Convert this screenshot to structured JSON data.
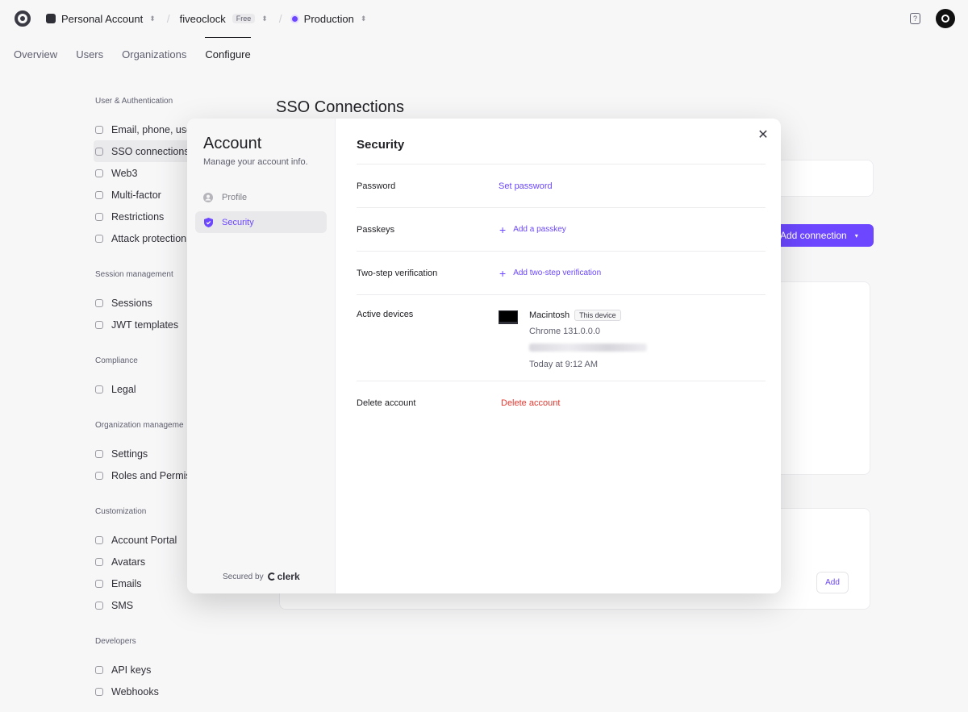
{
  "topbar": {
    "account": "Personal Account",
    "app": "fiveoclock",
    "plan_badge": "Free",
    "instance": "Production"
  },
  "tabs": [
    "Overview",
    "Users",
    "Organizations",
    "Configure"
  ],
  "sidebar": {
    "sections": [
      {
        "title": "User & Authentication",
        "items": [
          "Email, phone, use",
          "SSO connections",
          "Web3",
          "Multi-factor",
          "Restrictions",
          "Attack protection"
        ]
      },
      {
        "title": "Session management",
        "items": [
          "Sessions",
          "JWT templates"
        ]
      },
      {
        "title": "Compliance",
        "items": [
          "Legal"
        ]
      },
      {
        "title": "Organization manageme",
        "items": [
          "Settings",
          "Roles and Permis"
        ]
      },
      {
        "title": "Customization",
        "items": [
          "Account Portal",
          "Avatars",
          "Emails",
          "SMS"
        ]
      },
      {
        "title": "Developers",
        "items": [
          "API keys",
          "Webhooks"
        ]
      }
    ]
  },
  "main": {
    "title": "SSO Connections",
    "add_connection_label": "Add connection",
    "add_label": "Add"
  },
  "modal": {
    "title": "Account",
    "subtitle": "Manage your account info.",
    "nav": [
      {
        "label": "Profile",
        "icon": "user-circle-icon"
      },
      {
        "label": "Security",
        "icon": "shield-icon"
      }
    ],
    "secured_by": "Secured by",
    "brand": "clerk",
    "section_title": "Security",
    "rows": {
      "password": {
        "label": "Password",
        "action": "Set password"
      },
      "passkeys": {
        "label": "Passkeys",
        "action": "Add a passkey"
      },
      "two_step": {
        "label": "Two-step verification",
        "action": "Add two-step verification"
      },
      "devices": {
        "label": "Active devices",
        "device_name": "Macintosh",
        "this_device": "This device",
        "browser": "Chrome 131.0.0.0",
        "last_active": "Today at 9:12 AM"
      },
      "delete": {
        "label": "Delete account",
        "action": "Delete account"
      }
    }
  },
  "colors": {
    "accent": "#6c47ff",
    "danger": "#e5372f"
  }
}
